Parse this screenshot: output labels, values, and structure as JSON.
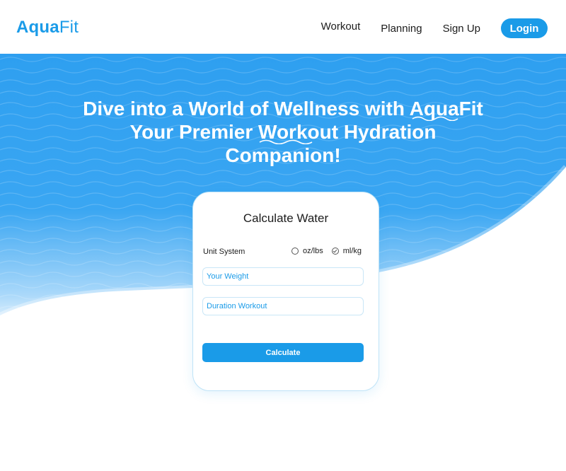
{
  "header": {
    "logo_bold": "Aqua",
    "logo_light": "Fit",
    "nav": {
      "workout": "Workout",
      "planning": "Planning",
      "signup": "Sign Up",
      "login": "Login"
    }
  },
  "hero": {
    "line1": "Dive into a World of Wellness with AquaFit",
    "line2": "Your Premier Workout Hydration",
    "line3": "Companion!"
  },
  "calculator": {
    "title": "Calculate Water",
    "unit_label": "Unit System",
    "unit_options": [
      "oz/lbs",
      "ml/kg"
    ],
    "selected_unit": "ml/kg",
    "weight_placeholder": "Your Weight",
    "duration_placeholder": "Duration Workout",
    "button_label": "Calculate"
  },
  "colors": {
    "accent": "#1a9be8",
    "hero_blue": "#2e9ff0",
    "text": "#1c1c1c",
    "card_border": "#bfe3f7"
  },
  "icons": {
    "radio_unchecked": "radio-circle-icon",
    "radio_checked": "radio-check-icon",
    "title_underline": "wave-underline-icon"
  }
}
